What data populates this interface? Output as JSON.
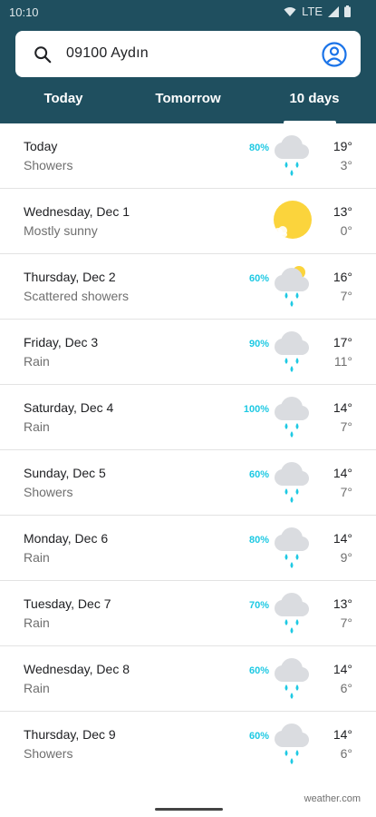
{
  "status_bar": {
    "time": "10:10",
    "network": "LTE"
  },
  "search": {
    "query": "09100 Aydın"
  },
  "tabs": [
    {
      "label": "Today"
    },
    {
      "label": "Tomorrow"
    },
    {
      "label": "10 days",
      "selected": true
    }
  ],
  "days": [
    {
      "name": "Today",
      "condition": "Showers",
      "precip": "80%",
      "high": "19°",
      "low": "3°",
      "icon": "showers-icon"
    },
    {
      "name": "Wednesday, Dec 1",
      "condition": "Mostly sunny",
      "precip": "",
      "high": "13°",
      "low": "0°",
      "icon": "mostly-sunny-icon"
    },
    {
      "name": "Thursday, Dec 2",
      "condition": "Scattered showers",
      "precip": "60%",
      "high": "16°",
      "low": "7°",
      "icon": "scattered-showers-icon"
    },
    {
      "name": "Friday, Dec 3",
      "condition": "Rain",
      "precip": "90%",
      "high": "17°",
      "low": "11°",
      "icon": "rain-icon"
    },
    {
      "name": "Saturday, Dec 4",
      "condition": "Rain",
      "precip": "100%",
      "high": "14°",
      "low": "7°",
      "icon": "rain-icon"
    },
    {
      "name": "Sunday, Dec 5",
      "condition": "Showers",
      "precip": "60%",
      "high": "14°",
      "low": "7°",
      "icon": "showers-icon"
    },
    {
      "name": "Monday, Dec 6",
      "condition": "Rain",
      "precip": "80%",
      "high": "14°",
      "low": "9°",
      "icon": "rain-icon"
    },
    {
      "name": "Tuesday, Dec 7",
      "condition": "Rain",
      "precip": "70%",
      "high": "13°",
      "low": "7°",
      "icon": "rain-icon"
    },
    {
      "name": "Wednesday, Dec 8",
      "condition": "Rain",
      "precip": "60%",
      "high": "14°",
      "low": "6°",
      "icon": "rain-icon"
    },
    {
      "name": "Thursday, Dec 9",
      "condition": "Showers",
      "precip": "60%",
      "high": "14°",
      "low": "6°",
      "icon": "showers-icon"
    }
  ],
  "footer": {
    "source": "weather.com"
  },
  "colors": {
    "header_bg": "#1f4f5f",
    "precip": "#1ec9e3",
    "sun": "#fbd43c",
    "cloud": "#dadce0",
    "rain_drop": "#1ec9e3"
  }
}
